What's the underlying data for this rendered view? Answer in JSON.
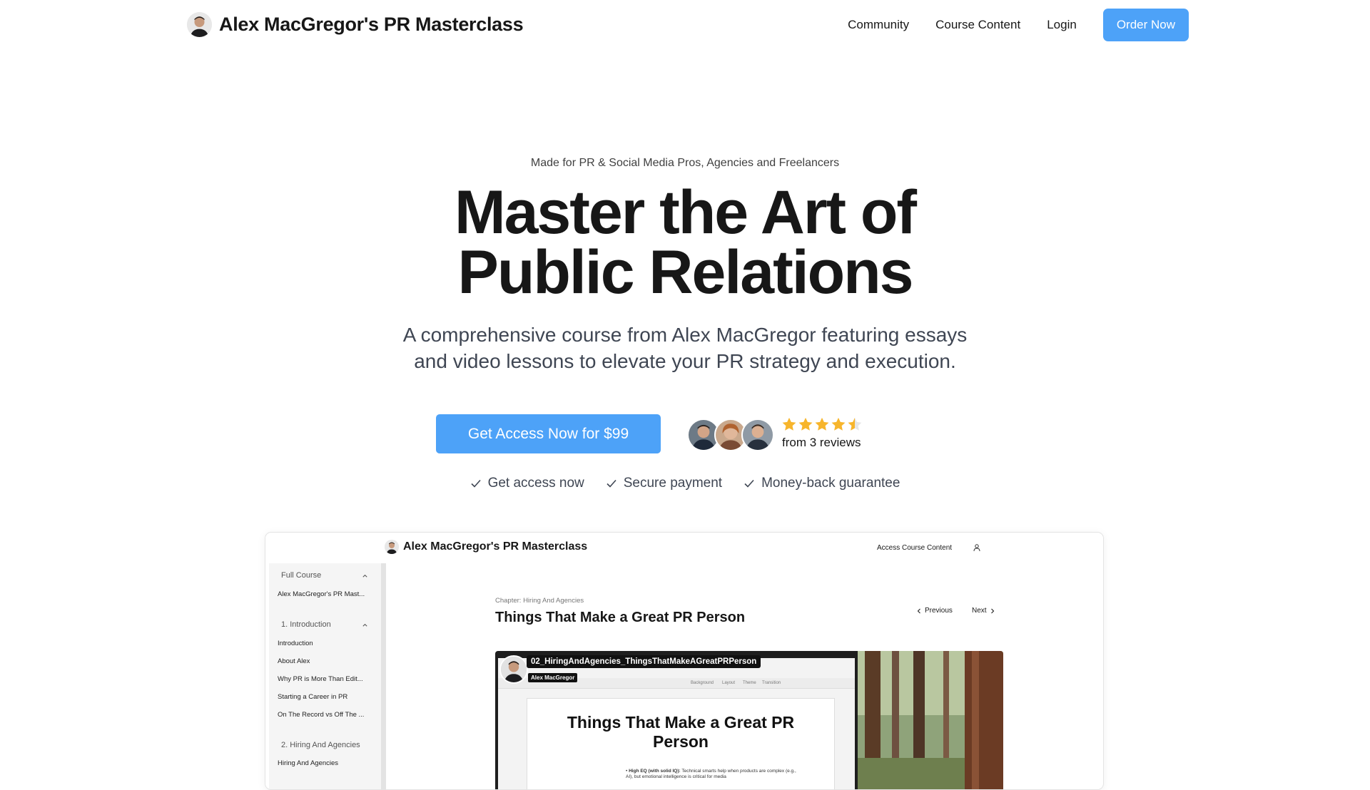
{
  "nav": {
    "title": "Alex MacGregor's PR Masterclass",
    "links": [
      "Community",
      "Course Content",
      "Login"
    ],
    "order_label": "Order Now"
  },
  "hero": {
    "eyebrow": "Made for PR & Social Media Pros, Agencies and Freelancers",
    "title_line1": "Master the Art of",
    "title_line2": "Public Relations",
    "subtitle_line1": "A comprehensive course from Alex MacGregor featuring essays",
    "subtitle_line2": "and video lessons to elevate your PR strategy and execution.",
    "cta_label": "Get Access Now for $99",
    "rating": 4.5,
    "reviews_text": "from 3 reviews",
    "features": [
      "Get access now",
      "Secure payment",
      "Money-back guarantee"
    ]
  },
  "preview": {
    "title": "Alex MacGregor's PR Masterclass",
    "access_label": "Access Course Content",
    "sidebar": {
      "full_course_header": "Full Course",
      "full_course_item": "Alex MacGregor's PR Mast...",
      "section1_header": "1. Introduction",
      "section1_items": [
        "Introduction",
        "About Alex",
        "Why PR is More Than Edit...",
        "Starting a Career in PR",
        "On The Record vs Off The ..."
      ],
      "section2_header": "2. Hiring And Agencies",
      "section2_items": [
        "Hiring And Agencies"
      ]
    },
    "chapter": "Chapter: Hiring And Agencies",
    "lesson_title": "Things That Make a Great PR Person",
    "prev_label": "Previous",
    "next_label": "Next",
    "video": {
      "file_label": "02_HiringAndAgencies_ThingsThatMakeAGreatPRPerson",
      "author": "Alex MacGregor",
      "toolbar_items": [
        "Background",
        "Layout",
        "Theme",
        "Transition"
      ],
      "slide_title_line1": "Things That Make a Great PR",
      "slide_title_line2": "Person",
      "slide_bullet_bold": "High EQ (with solid IQ):",
      "slide_bullet_text": "Technical smarts help when products are complex (e.g., AI), but emotional intelligence is critical for media"
    }
  },
  "colors": {
    "accent": "#4da2f8",
    "star": "#f7b52c",
    "text": "#171717",
    "muted": "#3f4653"
  },
  "icons": [
    "avatar",
    "star-icon",
    "check-icon",
    "chevron-up-icon",
    "chevron-left-icon",
    "chevron-right-icon",
    "user-icon"
  ]
}
